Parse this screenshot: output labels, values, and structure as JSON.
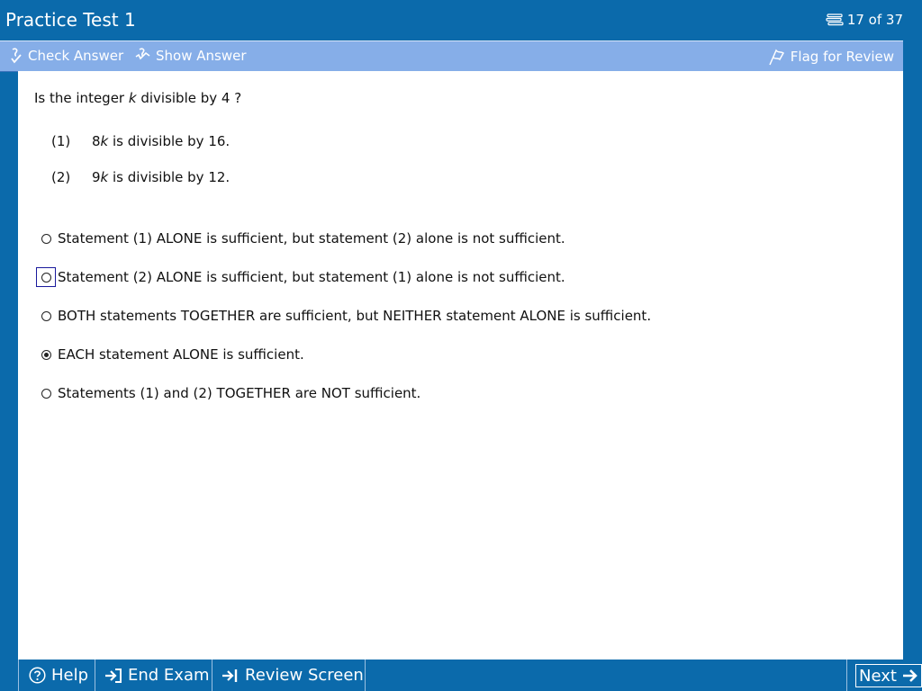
{
  "header": {
    "title": "Practice Test 1",
    "progress": "17 of 37"
  },
  "toolbar": {
    "check_answer": "Check Answer",
    "show_answer": "Show Answer",
    "flag_for_review": "Flag for Review"
  },
  "question": {
    "stem_prefix": "Is the integer ",
    "stem_var": "k",
    "stem_suffix": " divisible by 4 ?",
    "statements": [
      {
        "num": "(1)",
        "coef": "8",
        "var": "k",
        "rest": " is divisible by 16."
      },
      {
        "num": "(2)",
        "coef": "9",
        "var": "k",
        "rest": " is divisible by 12."
      }
    ],
    "choices": [
      {
        "label": "Statement (1) ALONE is sufficient, but statement (2) alone is not sufficient.",
        "checked": false
      },
      {
        "label": "Statement (2) ALONE is sufficient, but statement (1) alone is not sufficient.",
        "checked": false
      },
      {
        "label": "BOTH statements TOGETHER are sufficient, but NEITHER statement ALONE is sufficient.",
        "checked": false
      },
      {
        "label": "EACH statement ALONE is sufficient.",
        "checked": true
      },
      {
        "label": "Statements (1) and (2) TOGETHER are NOT sufficient.",
        "checked": false
      }
    ]
  },
  "footer": {
    "help": "Help",
    "end_exam": "End Exam",
    "review_screen": "Review Screen",
    "next": "Next"
  },
  "colors": {
    "frame": "#0b6aab",
    "toolbar": "#86aee8",
    "content": "#ffffff"
  },
  "icons": {
    "progress": "list-icon",
    "check": "check-answer-icon",
    "show": "show-answer-icon",
    "flag": "flag-icon",
    "help": "help-circle-icon",
    "end": "end-exam-icon",
    "review": "review-screen-icon",
    "next": "arrow-right-icon"
  }
}
